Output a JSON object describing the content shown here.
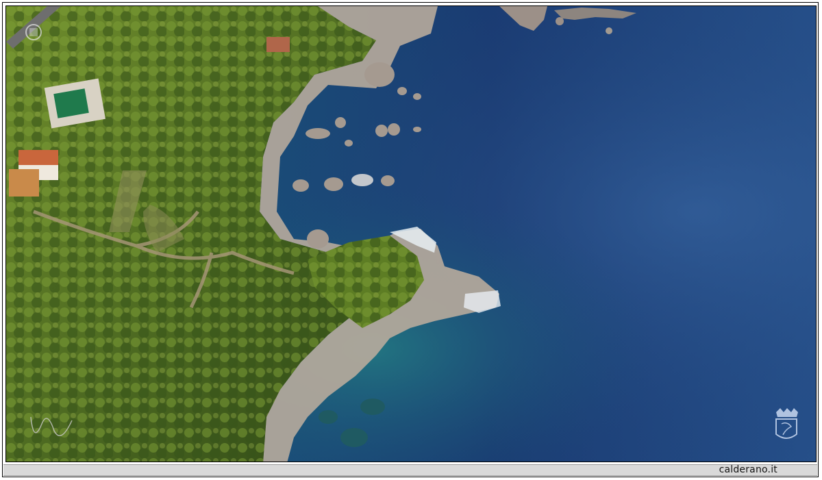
{
  "footer": {
    "site_label": "calderano.it"
  },
  "photo": {
    "subject": "coastline-aerial",
    "colors": {
      "deep_sea": "#1a3a6e",
      "shallow_sea": "#1d6f7c",
      "vegetation": "#5e7a2a",
      "vegetation_dark": "#2f4a16",
      "rock": "#b7a99a",
      "foam": "#e8eef2"
    },
    "icons": [
      "watermark-shield-icon",
      "watermark-crest-icon",
      "signature-mark"
    ]
  }
}
